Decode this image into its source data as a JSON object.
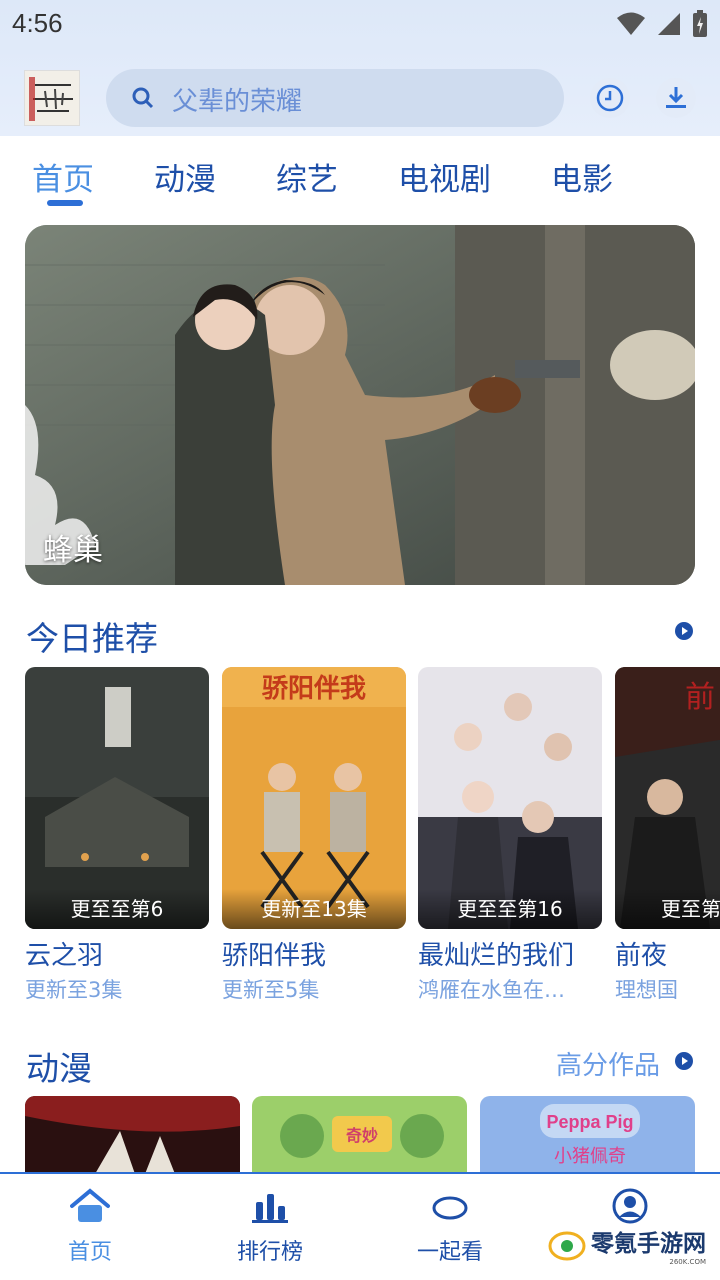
{
  "status_bar": {
    "time": "4:56"
  },
  "search": {
    "text": "父辈的荣耀"
  },
  "tabs": [
    {
      "label": "首页"
    },
    {
      "label": "动漫"
    },
    {
      "label": "综艺"
    },
    {
      "label": "电视剧"
    },
    {
      "label": "电影"
    }
  ],
  "banner": {
    "title": "蜂巢"
  },
  "today": {
    "title": "今日推荐",
    "items": [
      {
        "badge": "更至至第6",
        "title": "云之羽",
        "subtitle": "更新至3集"
      },
      {
        "badge": "更新至13集",
        "title": "骄阳伴我",
        "subtitle": "更新至5集"
      },
      {
        "badge": "更至至第16",
        "title": "最灿烂的我们",
        "subtitle": "鸿雁在水鱼在…"
      },
      {
        "badge": "更至第",
        "title": "前夜",
        "subtitle": "理想国"
      }
    ]
  },
  "anime": {
    "title": "动漫",
    "more": "高分作品"
  },
  "bottom_nav": [
    {
      "label": "首页",
      "icon": "home-icon"
    },
    {
      "label": "排行榜",
      "icon": "bar-chart-icon"
    },
    {
      "label": "一起看",
      "icon": "ellipse-icon"
    },
    {
      "label": "",
      "icon": "profile-icon"
    }
  ],
  "watermark": {
    "text": "零氪手游网",
    "sub": "260K.COM"
  },
  "colors": {
    "primary": "#1e4fa8",
    "accent": "#2d6fd6",
    "light_accent": "#6a9ce6"
  }
}
